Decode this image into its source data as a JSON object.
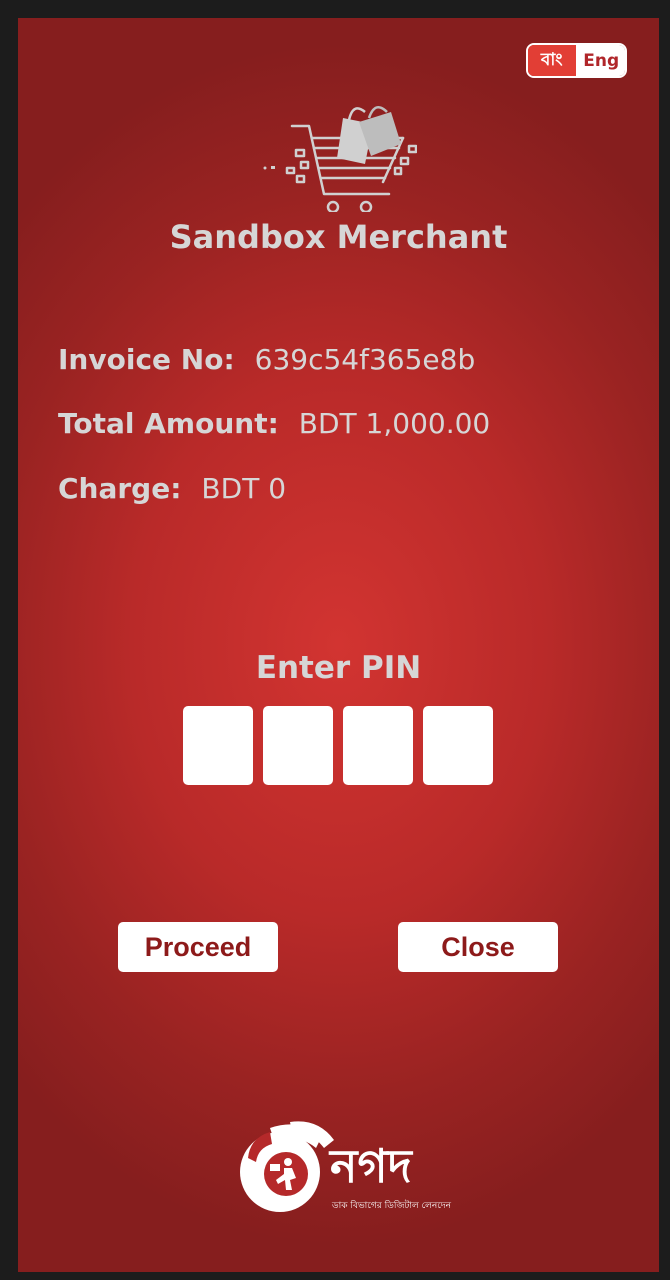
{
  "language_toggle": {
    "bangla_label": "বাং",
    "english_label": "Eng"
  },
  "merchant": {
    "name": "Sandbox Merchant",
    "icon": "shopping-cart-icon"
  },
  "invoice": {
    "invoice_label": "Invoice No:",
    "invoice_value": "639c54f365e8b",
    "amount_label": "Total Amount:",
    "amount_value": "BDT 1,000.00",
    "charge_label": "Charge:",
    "charge_value": "BDT 0"
  },
  "pin": {
    "title": "Enter PIN",
    "digits": [
      "",
      "",
      "",
      ""
    ]
  },
  "actions": {
    "proceed_label": "Proceed",
    "close_label": "Close"
  },
  "brand": {
    "logo_icon": "nagad-logo",
    "name": "নগদ",
    "tagline": "ডাক বিভাগের ডিজিটাল লেনদেন"
  },
  "colors": {
    "background_center": "#d23431",
    "background_edge": "#861e1e",
    "text_light": "#d6d6d6",
    "button_text": "#8d1a1a",
    "toggle_active": "#e23e35"
  }
}
